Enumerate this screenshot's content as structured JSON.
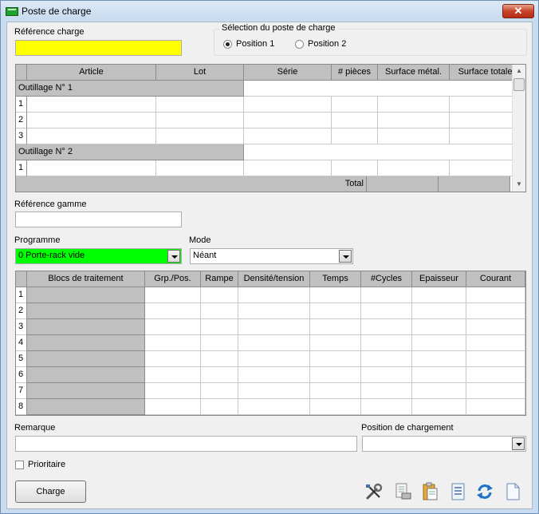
{
  "window": {
    "title": "Poste de charge",
    "close_glyph": "✕"
  },
  "reference_charge": {
    "label": "Référence charge",
    "value": ""
  },
  "selection": {
    "title": "Sélection du poste de charge",
    "options": [
      {
        "label": "Position 1",
        "selected": true
      },
      {
        "label": "Position 2",
        "selected": false
      }
    ]
  },
  "article_grid": {
    "columns": [
      "Article",
      "Lot",
      "Série",
      "# pièces",
      "Surface métal.",
      "Surface totale"
    ],
    "groups": [
      {
        "title": "Outillage N° 1",
        "rows": [
          "1",
          "2",
          "3"
        ]
      },
      {
        "title": "Outillage N° 2",
        "rows": [
          "1"
        ]
      }
    ],
    "total_label": "Total"
  },
  "reference_gamme": {
    "label": "Référence gamme",
    "value": ""
  },
  "programme": {
    "label": "Programme",
    "value": "0 Porte-rack vide",
    "highlight": "#00ff00"
  },
  "mode": {
    "label": "Mode",
    "value": "Néant"
  },
  "treatment_grid": {
    "columns": [
      "Blocs de traitement",
      "Grp./Pos.",
      "Rampe",
      "Densité/tension",
      "Temps",
      "#Cycles",
      "Epaisseur",
      "Courant"
    ],
    "rows": [
      "1",
      "2",
      "3",
      "4",
      "5",
      "6",
      "7",
      "8"
    ]
  },
  "remarque": {
    "label": "Remarque",
    "value": ""
  },
  "position_chargement": {
    "label": "Position de chargement",
    "value": ""
  },
  "prioritaire": {
    "label": "Prioritaire",
    "checked": false
  },
  "charge_button": {
    "label": "Charge"
  },
  "toolbar_icons": [
    "tools-icon",
    "print-preview-icon",
    "clipboard-icon",
    "document-list-icon",
    "refresh-icon",
    "new-document-icon"
  ],
  "colors": {
    "required_field": "#ffff00",
    "programme_field": "#00ff00",
    "header_gray": "#c0c0c0"
  }
}
